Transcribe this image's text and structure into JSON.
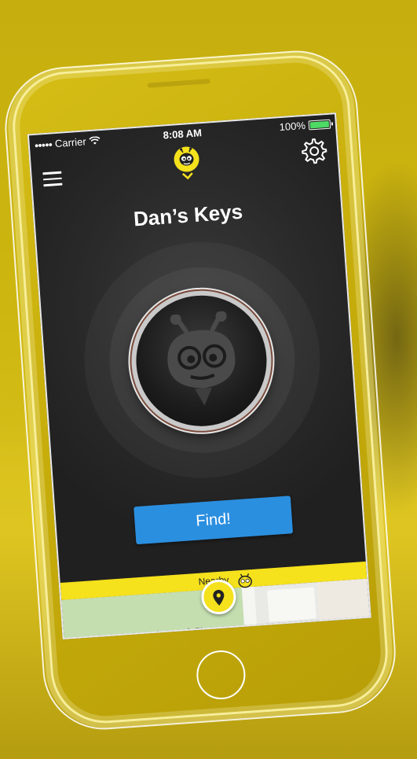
{
  "status_bar": {
    "carrier": "Carrier",
    "time": "8:08 AM",
    "battery_label": "100%",
    "battery_level": 1.0
  },
  "header": {
    "title": "Dan’s Keys"
  },
  "actions": {
    "find_label": "Find!"
  },
  "nearby": {
    "label": "Nearby"
  },
  "map": {
    "street_label": "Issaquah-Pi..."
  },
  "icons": {
    "menu": "hamburger-menu-icon",
    "settings": "gear-icon",
    "brand": "bee-logo-icon",
    "location": "location-pin-icon",
    "signal": "wifi-icon"
  },
  "colors": {
    "accent_yellow": "#f5e11c",
    "button_blue": "#2b8fe0",
    "battery_green": "#4cd964",
    "screen_dark": "#2a2a2a"
  }
}
